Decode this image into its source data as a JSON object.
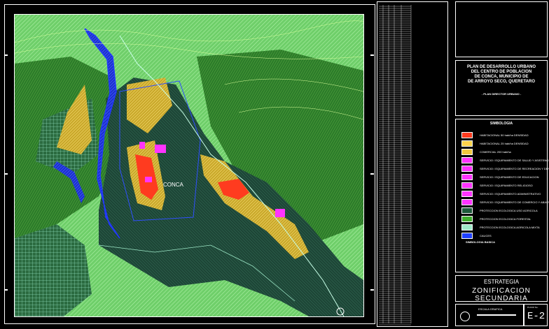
{
  "title": {
    "main": [
      "PLAN DE DESARROLLO URBANO",
      "DEL CENTRO DE POBLACION",
      "DE CONCA, MUNICIPIO DE",
      "DE ARROYO SECO, QUERETARO"
    ],
    "sub": "- PLAN DIRECTOR URBANO -"
  },
  "legend": {
    "heading": "SIMBOLOGIA",
    "items": [
      {
        "label": "HABITACIONAL 50 hab/ha DENSIDAD",
        "color": "#ff3b1f"
      },
      {
        "label": "HABITACIONAL 25 hab/ha DENSIDAD",
        "color": "#ffd24a"
      },
      {
        "label": "COMERCIAL 200 hab/ha",
        "color": "#f0c840"
      },
      {
        "label": "SERVICIO / EQUIPAMIENTO DE SALUD Y ASISTENCIA",
        "color": "#ff33ff"
      },
      {
        "label": "SERVICIO / EQUIPAMIENTO DE RECREACION Y DEPORTE",
        "color": "#ff33ff"
      },
      {
        "label": "SERVICIO / EQUIPAMIENTO DE EDUCACION",
        "color": "#ff33ff"
      },
      {
        "label": "SERVICIO / EQUIPAMIENTO RELIGIOSO",
        "color": "#ff33ff"
      },
      {
        "label": "SERVICIO / EQUIPAMIENTO ADMINISTRATIVO",
        "color": "#ff33ff"
      },
      {
        "label": "SERVICIO / EQUIPAMIENTO DE COMERCIO Y ABASTO",
        "color": "#ff33ff"
      },
      {
        "label": "PROTECCION ECOLOGICA USO AGRICOLA",
        "color": "#1e5a3a"
      },
      {
        "label": "PROTECCION ECOLOGICA FORESTAL",
        "color": "#3fae2e"
      },
      {
        "label": "PROTECCION ECOLOGICA AGRICOLA MIXTA",
        "color": "#9ee8c8"
      },
      {
        "label": "CAUCES",
        "color": "#2040ff"
      }
    ],
    "base_heading": "SIMBOLOGIA BASICA"
  },
  "map": {
    "town_label": "CONCA"
  },
  "stage": "ESTRATEGIA",
  "zone": "ZONIFICACION SECUNDARIA",
  "scale_label": "ESCALA GRAFICA",
  "sheet_label": "PLANO No.",
  "sheet_id": "E-2",
  "colors": {
    "background": "#000000",
    "terrain_dark": "#1e4a3a",
    "terrain_green": "#2f8a2a",
    "terrain_light": "#8fe08a",
    "river": "#2238ff",
    "urban_yellow": "#ffd24a",
    "urban_red": "#ff3b1f",
    "equipment": "#ff33ff"
  }
}
